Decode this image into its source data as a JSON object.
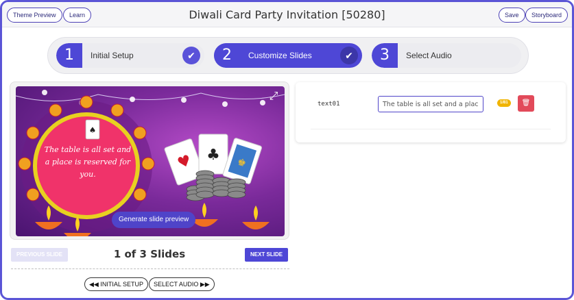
{
  "header": {
    "theme_preview": "Theme Preview",
    "learn": "Learn",
    "title": "Diwali Card Party Invitation [50280]",
    "save": "Save",
    "storyboard": "Storyboard"
  },
  "steps": [
    {
      "num": "1",
      "label": "Initial Setup",
      "state": "complete"
    },
    {
      "num": "2",
      "label": "Customize Slides",
      "state": "active"
    },
    {
      "num": "3",
      "label": "Select Audio",
      "state": "pending"
    }
  ],
  "preview": {
    "slide_text": "The table is all set and a place is reserved for you.",
    "generate_label": "Generate slide preview"
  },
  "navigation": {
    "previous": "PREVIOUS SLIDE",
    "next": "NEXT SLIDE",
    "count": "1 of 3 Slides",
    "initial_setup": "INITIAL SETUP",
    "select_audio": "SELECT AUDIO"
  },
  "text_fields": [
    {
      "label": "text01",
      "value": "The table is all set and a place",
      "count": "1/81"
    }
  ],
  "colors": {
    "accent": "#4e47d6",
    "badge": "#f0b400",
    "delete": "#e24a5a"
  }
}
